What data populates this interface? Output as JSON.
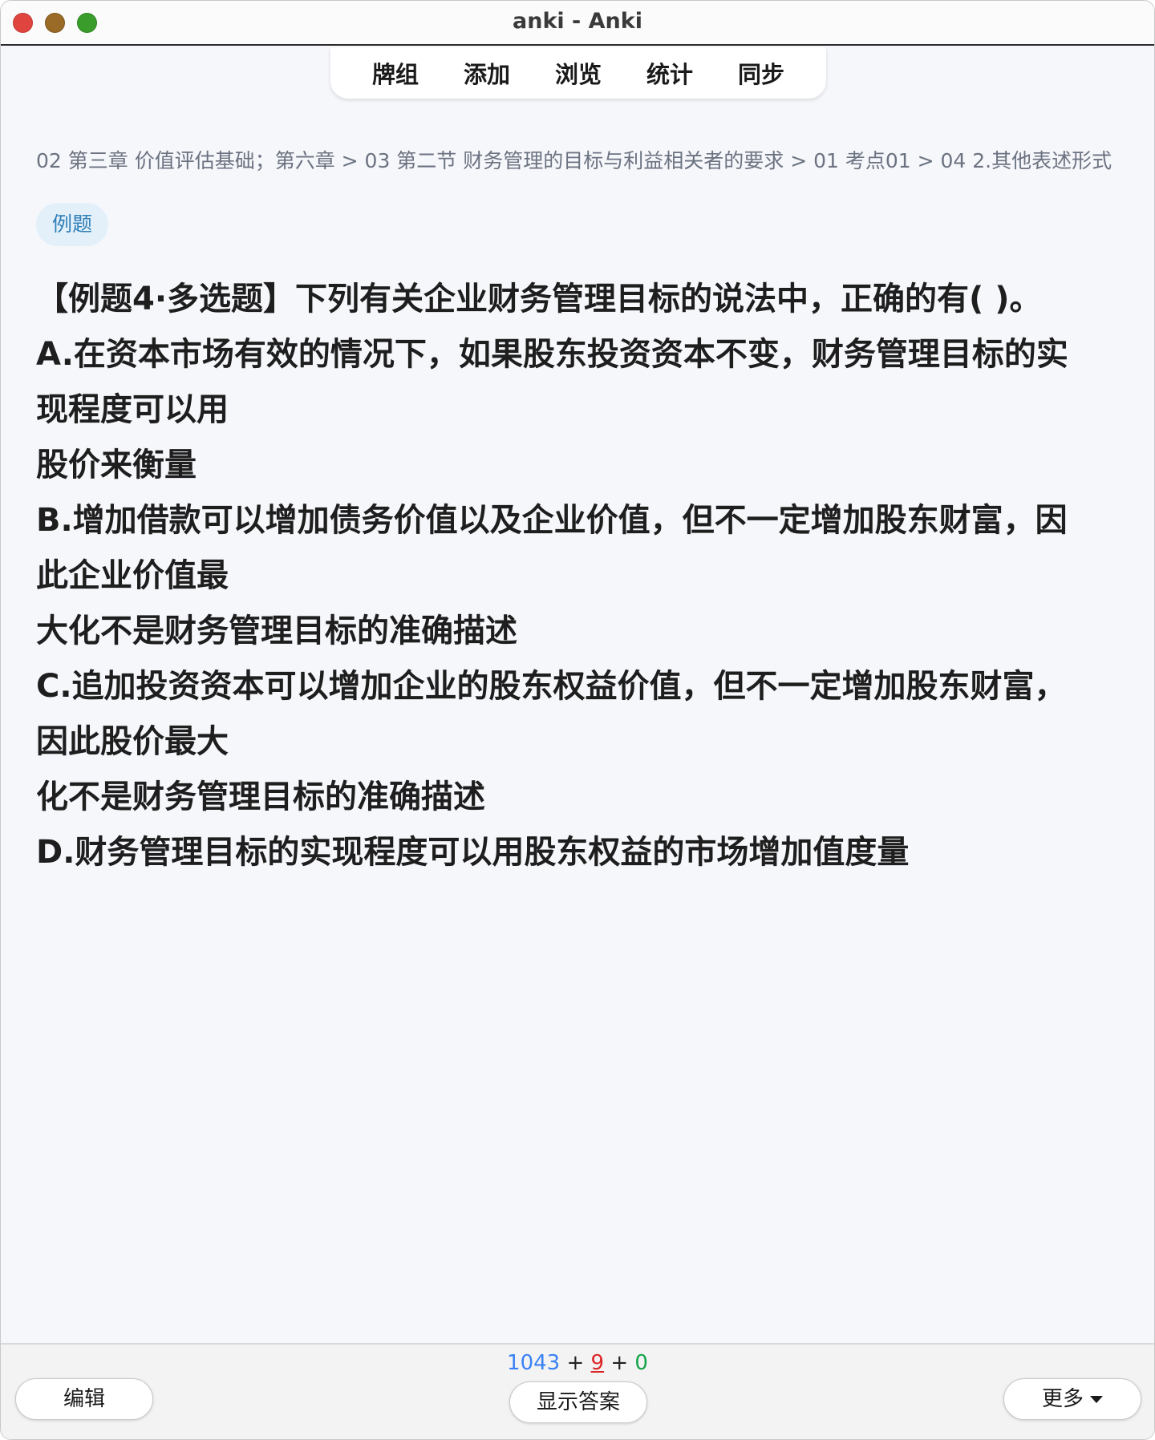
{
  "window": {
    "title": "anki - Anki"
  },
  "toolbar": {
    "items": [
      "牌组",
      "添加",
      "浏览",
      "统计",
      "同步"
    ]
  },
  "card": {
    "breadcrumb": "02 第三章 价值评估基础；第六章 > 03 第二节 财务管理的目标与利益相关者的要求 > 01 考点01 > 04 2.其他表述形式",
    "tag": "例题",
    "question_lines": [
      "【例题4·多选题】下列有关企业财务管理目标的说法中，正确的有( )。",
      "A.在资本市场有效的情况下，如果股东投资资本不变，财务管理目标的实",
      "现程度可以用",
      "股价来衡量",
      "B.增加借款可以增加债务价值以及企业价值，但不一定增加股东财富，因",
      "此企业价值最",
      "大化不是财务管理目标的准确描述",
      "C.追加投资资本可以增加企业的股东权益价值，但不一定增加股东财富，",
      "因此股价最大",
      "化不是财务管理目标的准确描述",
      "D.财务管理目标的实现程度可以用股东权益的市场增加值度量"
    ]
  },
  "bottombar": {
    "edit_label": "编辑",
    "show_answer_label": "显示答案",
    "more_label": "更多",
    "counts": {
      "new": "1043",
      "learn": "9",
      "review": "0",
      "separator": "+"
    }
  },
  "colors": {
    "new": "#3b82f6",
    "learn": "#dc2626",
    "review": "#16a34a",
    "tag_bg": "#e3f0fa",
    "tag_text": "#2f7fb8"
  }
}
